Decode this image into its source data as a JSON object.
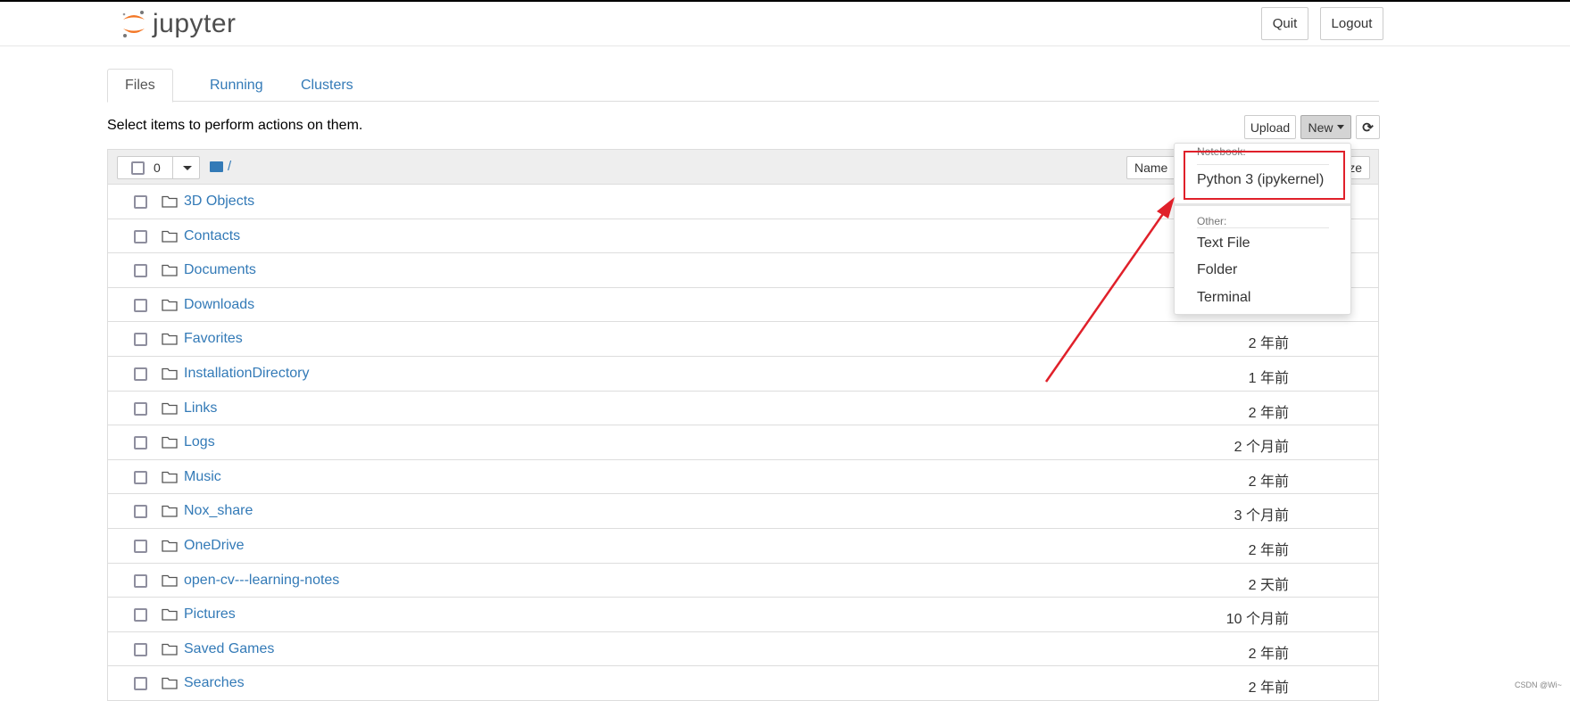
{
  "header": {
    "logo_text": "jupyter",
    "quit": "Quit",
    "logout": "Logout"
  },
  "tabs": [
    {
      "label": "Files",
      "active": true
    },
    {
      "label": "Running"
    },
    {
      "label": "Clusters"
    }
  ],
  "hint": "Select items to perform actions on them.",
  "toolbar": {
    "upload": "Upload",
    "new": "New",
    "refresh_icon": "refresh-icon"
  },
  "list_header": {
    "selected_count": "0",
    "path": "/",
    "sort_name": "Name",
    "last_col_partial": "ze"
  },
  "new_menu": {
    "notebook_header": "Notebook:",
    "notebook_items": [
      "Python 3 (ipykernel)"
    ],
    "other_header": "Other:",
    "other_items": [
      "Text File",
      "Folder",
      "Terminal"
    ]
  },
  "files": [
    {
      "name": "3D Objects",
      "modified": ""
    },
    {
      "name": "Contacts",
      "modified": ""
    },
    {
      "name": "Documents",
      "modified": ""
    },
    {
      "name": "Downloads",
      "modified": ""
    },
    {
      "name": "Favorites",
      "modified": "2 年前"
    },
    {
      "name": "InstallationDirectory",
      "modified": "1 年前"
    },
    {
      "name": "Links",
      "modified": "2 年前"
    },
    {
      "name": "Logs",
      "modified": "2 个月前"
    },
    {
      "name": "Music",
      "modified": "2 年前"
    },
    {
      "name": "Nox_share",
      "modified": "3 个月前"
    },
    {
      "name": "OneDrive",
      "modified": "2 年前"
    },
    {
      "name": "open-cv---learning-notes",
      "modified": "2 天前"
    },
    {
      "name": "Pictures",
      "modified": "10 个月前"
    },
    {
      "name": "Saved Games",
      "modified": "2 年前"
    },
    {
      "name": "Searches",
      "modified": "2 年前"
    }
  ],
  "annotation_color": "#e0202a",
  "watermark": "CSDN @Wi~"
}
